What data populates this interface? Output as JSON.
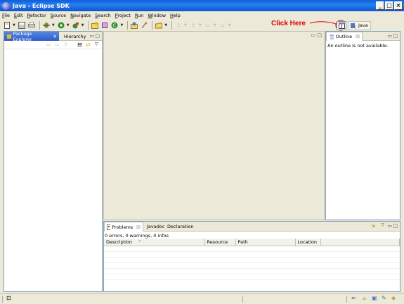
{
  "window": {
    "title": "Java - Eclipse SDK",
    "min": "_",
    "max": "□",
    "close": "×"
  },
  "menu": [
    "File",
    "Edit",
    "Refactor",
    "Source",
    "Navigate",
    "Search",
    "Project",
    "Run",
    "Window",
    "Help"
  ],
  "annotation": {
    "text": "Click Here",
    "color": "#e00000"
  },
  "perspective": {
    "active": "Java"
  },
  "left_panel": {
    "tabs": [
      "Package Explorer",
      "Hierarchy"
    ],
    "active_tab": "Package Explorer",
    "close_glyph": "✕"
  },
  "outline": {
    "tab": "Outline",
    "close_glyph": "☒",
    "message": "An outline is not available."
  },
  "problems": {
    "tabs": [
      "Problems",
      "Javadoc",
      "Declaration"
    ],
    "summary": "0 errors, 0 warnings, 0 infos",
    "columns": [
      "Description",
      "Resource",
      "Path",
      "Location"
    ],
    "close_glyph": "☒",
    "sort_glyph": "^"
  },
  "colors": {
    "accent": "#2b5cc6",
    "title": "#0a5fd8",
    "annotation": "#e00000"
  }
}
